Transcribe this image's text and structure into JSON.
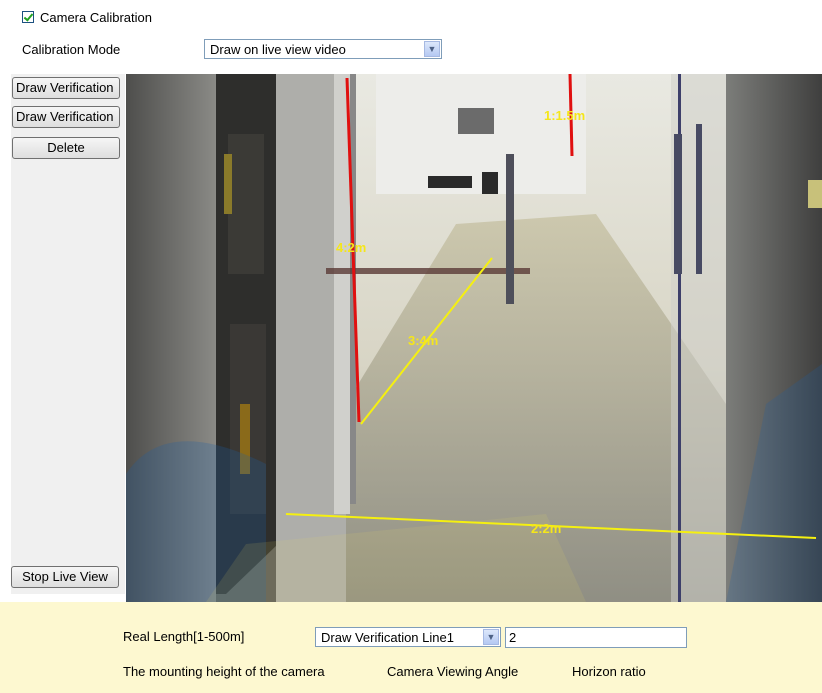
{
  "calibration": {
    "checkbox_label": "Camera Calibration",
    "checked": true,
    "mode_label": "Calibration Mode",
    "mode_value": "Draw on live view video"
  },
  "left_buttons": {
    "draw_verification_1": "Draw Verification",
    "draw_verification_2": "Draw Verification",
    "delete": "Delete",
    "stop_live_view": "Stop Live View"
  },
  "video": {
    "line_labels": {
      "red_left": "4:2m",
      "red_right": "1:1.5m",
      "yellow_diagonal": "3:4m",
      "yellow_bottom": "2:2m"
    },
    "colors": {
      "vertical_lines": "#e01010",
      "diagonal_lines": "#f5f010",
      "label_text": "#f5e61a"
    }
  },
  "bottom_panel": {
    "real_length_label": "Real Length[1-500m]",
    "line_select_value": "Draw Verification Line1",
    "length_value": "2",
    "params": {
      "mounting_height": "The mounting height of the camera",
      "viewing_angle": "Camera Viewing Angle",
      "horizon_ratio": "Horizon ratio"
    }
  },
  "icons": {
    "dropdown": "chevron-down-icon",
    "checkbox": "check-icon"
  }
}
